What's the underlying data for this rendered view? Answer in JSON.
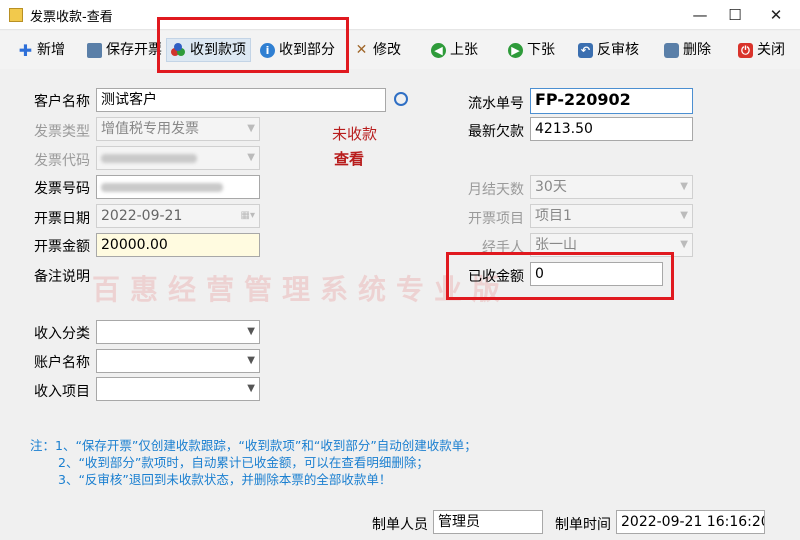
{
  "window": {
    "title": "发票收款-查看",
    "minimize": "—",
    "maximize": "☐",
    "close": "✕"
  },
  "toolbar": {
    "new": "新增",
    "save_invoice": "保存开票",
    "receive_full": "收到款项",
    "receive_part": "收到部分",
    "edit": "修改",
    "prev": "上张",
    "next": "下张",
    "unapprove": "反审核",
    "delete": "删除",
    "close": "关闭"
  },
  "form": {
    "customer_label": "客户名称",
    "customer_value": "测试客户",
    "invoice_type_label": "发票类型",
    "invoice_type_value": "增值税专用发票",
    "invoice_code_label": "发票代码",
    "invoice_no_label": "发票号码",
    "invoice_date_label": "开票日期",
    "invoice_date_value": "2022-09-21",
    "amount_label": "开票金额",
    "amount_value": "20000.00",
    "remark_label": "备注说明",
    "serial_label": "流水单号",
    "serial_value": "FP-220902",
    "balance_label": "最新欠款",
    "balance_value": "4213.50",
    "settle_days_label": "月结天数",
    "settle_days_value": "30天",
    "item_label": "开票项目",
    "item_value": "项目1",
    "handler_label": "经手人",
    "handler_value": "张一山",
    "received_label": "已收金额",
    "received_value": "0",
    "income_cat_label": "收入分类",
    "account_label": "账户名称",
    "income_item_label": "收入项目"
  },
  "status": {
    "line1": "未收款",
    "line2": "查看"
  },
  "watermark": "百惠经营管理系统专业版",
  "notes": [
    "注：1、“保存开票”仅创建收款跟踪，“收到款项”和“收到部分”自动创建收款单；",
    "2、“收到部分”款项时，自动累计已收金额，可以在查看明细删除；",
    "3、“反审核”退回到未收款状态，并删除本票的全部收款单！"
  ],
  "footer": {
    "creator_label": "制单人员",
    "creator_value": "管理员",
    "time_label": "制单时间",
    "time_value": "2022-09-21 16:16:20"
  },
  "colors": {
    "highlight_border": "#e0191f",
    "note_text": "#1a7fd0",
    "status_text": "#b81d1d"
  }
}
